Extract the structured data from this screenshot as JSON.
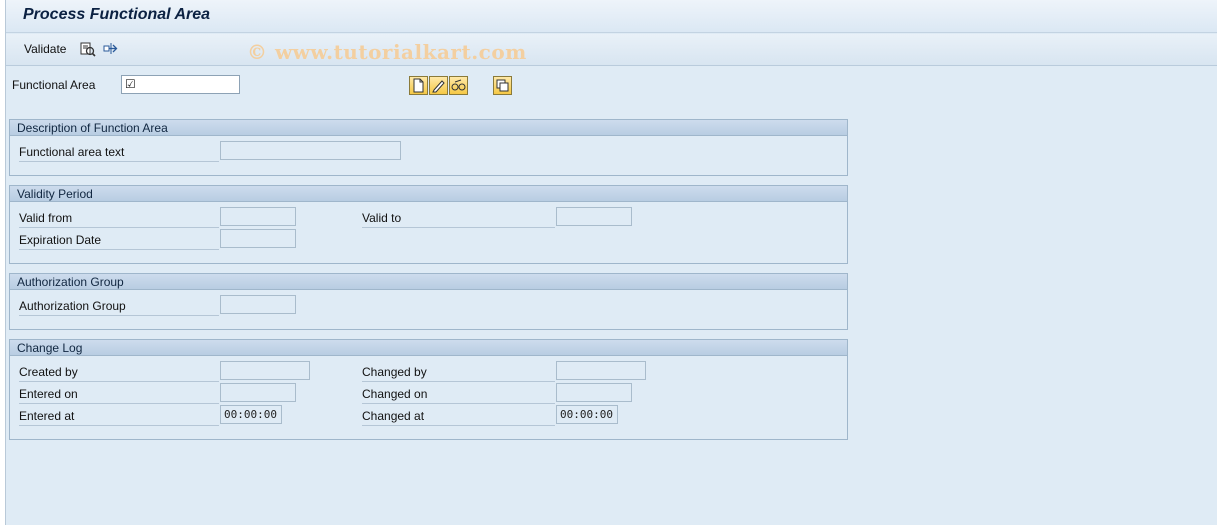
{
  "title": "Process Functional Area",
  "toolbar": {
    "validate_label": "Validate",
    "watermark": "© www.tutorialkart.com"
  },
  "functional_area": {
    "label": "Functional Area",
    "value": "☑"
  },
  "groups": {
    "description": {
      "header": "Description of Function Area",
      "text_label": "Functional area text"
    },
    "validity": {
      "header": "Validity Period",
      "valid_from_label": "Valid from",
      "valid_to_label": "Valid to",
      "expiration_label": "Expiration Date"
    },
    "authorization": {
      "header": "Authorization Group",
      "group_label": "Authorization Group"
    },
    "changelog": {
      "header": "Change Log",
      "created_by_label": "Created by",
      "changed_by_label": "Changed by",
      "entered_on_label": "Entered on",
      "changed_on_label": "Changed on",
      "entered_at_label": "Entered at",
      "entered_at_value": "00:00:00",
      "changed_at_label": "Changed at",
      "changed_at_value": "00:00:00"
    }
  },
  "icons": {
    "toolbar": [
      "where-used-icon",
      "navigate-icon"
    ],
    "actions": [
      "create-icon",
      "change-icon",
      "display-icon",
      "copy-icon"
    ]
  },
  "colors": {
    "background": "#dfebf5",
    "title": "#0b2142",
    "watermark": "#f3cfa0"
  }
}
